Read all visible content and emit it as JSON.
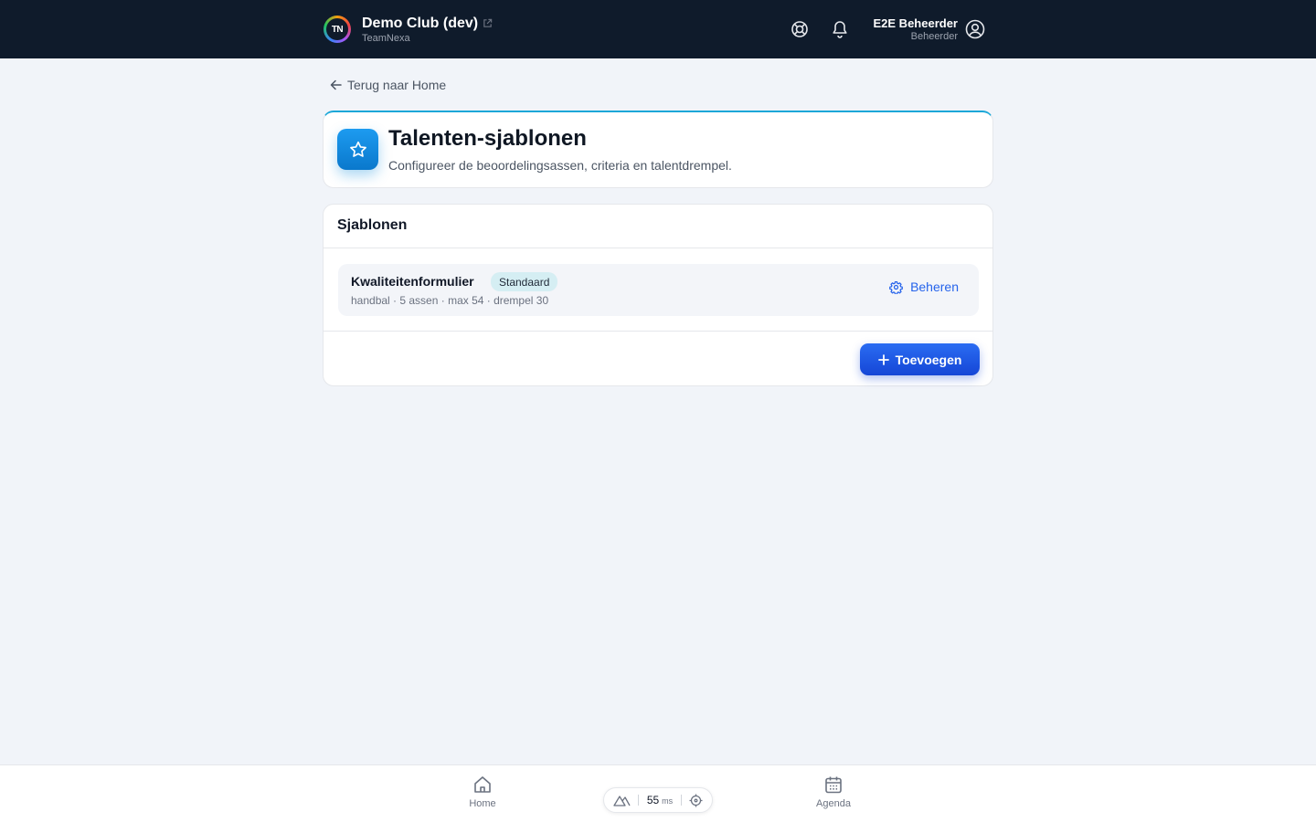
{
  "header": {
    "logo_text": "TN",
    "club_name": "Demo Club (dev)",
    "org_name": "TeamNexa",
    "user_name": "E2E Beheerder",
    "user_role": "Beheerder",
    "icons": [
      "external-link-icon",
      "help-lifebuoy-icon",
      "bell-icon",
      "user-circle-icon"
    ]
  },
  "back_link": {
    "label": "Terug naar Home"
  },
  "page": {
    "title": "Talenten-sjablonen",
    "subtitle": "Configureer de beoordelingsassen, criteria en talentdrempel."
  },
  "templates": {
    "section_title": "Sjablonen",
    "items": [
      {
        "name": "Kwaliteitenformulier",
        "badge": "Standaard",
        "meta": "handbal · 5 assen · max 54 · drempel 30",
        "action_label": "Beheren"
      }
    ],
    "add_label": "Toevoegen"
  },
  "bottom_nav": {
    "home_label": "Home",
    "agenda_label": "Agenda",
    "perf_value": "55",
    "perf_unit": "ms"
  },
  "colors": {
    "topbar": "#0f1b2b",
    "accent": "#2563eb",
    "header_icon": "#1d9bf0",
    "badge_bg": "#d5eef3"
  }
}
